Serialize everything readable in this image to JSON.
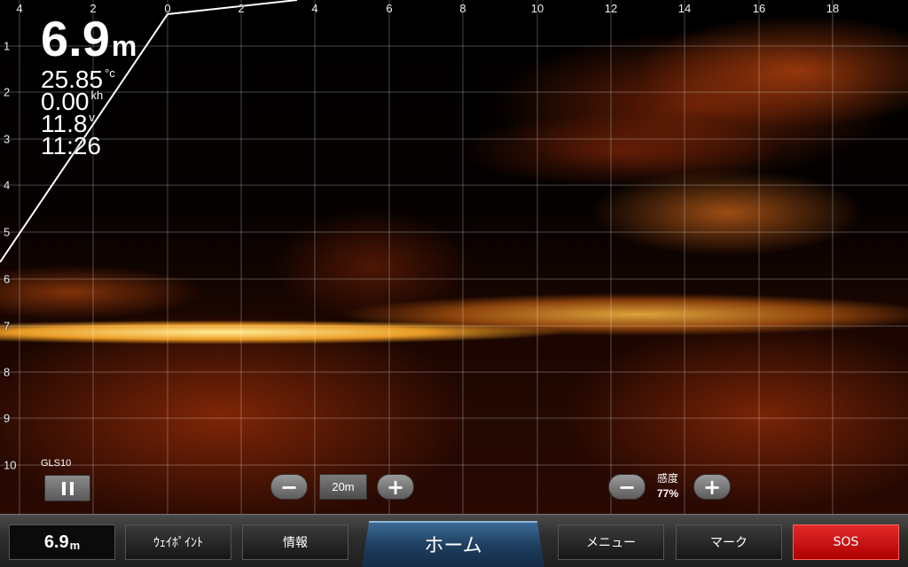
{
  "hud": {
    "depth": {
      "value": "6.9",
      "unit": "m"
    },
    "temperature": {
      "value": "25.85",
      "unit": "°c"
    },
    "speed": {
      "value": "0.00",
      "unit": "kh"
    },
    "voltage": {
      "value": "11.8",
      "unit": "v"
    },
    "time": "11:26"
  },
  "x_axis_ticks": [
    "4",
    "2",
    "0",
    "2",
    "4",
    "6",
    "8",
    "10",
    "12",
    "14",
    "16",
    "18"
  ],
  "y_axis_ticks": [
    "1",
    "2",
    "3",
    "4",
    "5",
    "6",
    "7",
    "8",
    "9",
    "10"
  ],
  "transducer": {
    "label": "GLS10",
    "state": "paused"
  },
  "range": {
    "value": "20m",
    "minus": "−",
    "plus": "+"
  },
  "sensitivity": {
    "label": "感度",
    "value": "77%",
    "minus": "−",
    "plus": "+"
  },
  "bottom_bar": {
    "depth_value": "6.9",
    "depth_unit": "m",
    "waypoint": "ｳｪｲﾎﾟｲﾝﾄ",
    "info": "情報",
    "home": "ホーム",
    "menu": "メニュー",
    "mark": "マーク",
    "sos": "SOS"
  },
  "colors": {
    "sonar_return": "#ff9a1e",
    "sos": "#d00000",
    "home_tab": "#2a5680"
  }
}
